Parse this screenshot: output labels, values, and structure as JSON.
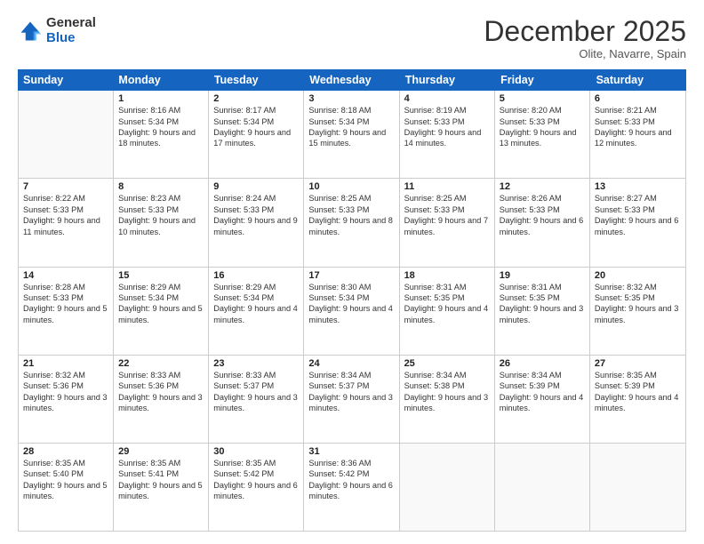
{
  "logo": {
    "general": "General",
    "blue": "Blue"
  },
  "title": "December 2025",
  "subtitle": "Olite, Navarre, Spain",
  "header_days": [
    "Sunday",
    "Monday",
    "Tuesday",
    "Wednesday",
    "Thursday",
    "Friday",
    "Saturday"
  ],
  "rows": [
    [
      {
        "day": "",
        "sunrise": "",
        "sunset": "",
        "daylight": ""
      },
      {
        "day": "1",
        "sunrise": "Sunrise: 8:16 AM",
        "sunset": "Sunset: 5:34 PM",
        "daylight": "Daylight: 9 hours and 18 minutes."
      },
      {
        "day": "2",
        "sunrise": "Sunrise: 8:17 AM",
        "sunset": "Sunset: 5:34 PM",
        "daylight": "Daylight: 9 hours and 17 minutes."
      },
      {
        "day": "3",
        "sunrise": "Sunrise: 8:18 AM",
        "sunset": "Sunset: 5:34 PM",
        "daylight": "Daylight: 9 hours and 15 minutes."
      },
      {
        "day": "4",
        "sunrise": "Sunrise: 8:19 AM",
        "sunset": "Sunset: 5:33 PM",
        "daylight": "Daylight: 9 hours and 14 minutes."
      },
      {
        "day": "5",
        "sunrise": "Sunrise: 8:20 AM",
        "sunset": "Sunset: 5:33 PM",
        "daylight": "Daylight: 9 hours and 13 minutes."
      },
      {
        "day": "6",
        "sunrise": "Sunrise: 8:21 AM",
        "sunset": "Sunset: 5:33 PM",
        "daylight": "Daylight: 9 hours and 12 minutes."
      }
    ],
    [
      {
        "day": "7",
        "sunrise": "Sunrise: 8:22 AM",
        "sunset": "Sunset: 5:33 PM",
        "daylight": "Daylight: 9 hours and 11 minutes."
      },
      {
        "day": "8",
        "sunrise": "Sunrise: 8:23 AM",
        "sunset": "Sunset: 5:33 PM",
        "daylight": "Daylight: 9 hours and 10 minutes."
      },
      {
        "day": "9",
        "sunrise": "Sunrise: 8:24 AM",
        "sunset": "Sunset: 5:33 PM",
        "daylight": "Daylight: 9 hours and 9 minutes."
      },
      {
        "day": "10",
        "sunrise": "Sunrise: 8:25 AM",
        "sunset": "Sunset: 5:33 PM",
        "daylight": "Daylight: 9 hours and 8 minutes."
      },
      {
        "day": "11",
        "sunrise": "Sunrise: 8:25 AM",
        "sunset": "Sunset: 5:33 PM",
        "daylight": "Daylight: 9 hours and 7 minutes."
      },
      {
        "day": "12",
        "sunrise": "Sunrise: 8:26 AM",
        "sunset": "Sunset: 5:33 PM",
        "daylight": "Daylight: 9 hours and 6 minutes."
      },
      {
        "day": "13",
        "sunrise": "Sunrise: 8:27 AM",
        "sunset": "Sunset: 5:33 PM",
        "daylight": "Daylight: 9 hours and 6 minutes."
      }
    ],
    [
      {
        "day": "14",
        "sunrise": "Sunrise: 8:28 AM",
        "sunset": "Sunset: 5:33 PM",
        "daylight": "Daylight: 9 hours and 5 minutes."
      },
      {
        "day": "15",
        "sunrise": "Sunrise: 8:29 AM",
        "sunset": "Sunset: 5:34 PM",
        "daylight": "Daylight: 9 hours and 5 minutes."
      },
      {
        "day": "16",
        "sunrise": "Sunrise: 8:29 AM",
        "sunset": "Sunset: 5:34 PM",
        "daylight": "Daylight: 9 hours and 4 minutes."
      },
      {
        "day": "17",
        "sunrise": "Sunrise: 8:30 AM",
        "sunset": "Sunset: 5:34 PM",
        "daylight": "Daylight: 9 hours and 4 minutes."
      },
      {
        "day": "18",
        "sunrise": "Sunrise: 8:31 AM",
        "sunset": "Sunset: 5:35 PM",
        "daylight": "Daylight: 9 hours and 4 minutes."
      },
      {
        "day": "19",
        "sunrise": "Sunrise: 8:31 AM",
        "sunset": "Sunset: 5:35 PM",
        "daylight": "Daylight: 9 hours and 3 minutes."
      },
      {
        "day": "20",
        "sunrise": "Sunrise: 8:32 AM",
        "sunset": "Sunset: 5:35 PM",
        "daylight": "Daylight: 9 hours and 3 minutes."
      }
    ],
    [
      {
        "day": "21",
        "sunrise": "Sunrise: 8:32 AM",
        "sunset": "Sunset: 5:36 PM",
        "daylight": "Daylight: 9 hours and 3 minutes."
      },
      {
        "day": "22",
        "sunrise": "Sunrise: 8:33 AM",
        "sunset": "Sunset: 5:36 PM",
        "daylight": "Daylight: 9 hours and 3 minutes."
      },
      {
        "day": "23",
        "sunrise": "Sunrise: 8:33 AM",
        "sunset": "Sunset: 5:37 PM",
        "daylight": "Daylight: 9 hours and 3 minutes."
      },
      {
        "day": "24",
        "sunrise": "Sunrise: 8:34 AM",
        "sunset": "Sunset: 5:37 PM",
        "daylight": "Daylight: 9 hours and 3 minutes."
      },
      {
        "day": "25",
        "sunrise": "Sunrise: 8:34 AM",
        "sunset": "Sunset: 5:38 PM",
        "daylight": "Daylight: 9 hours and 3 minutes."
      },
      {
        "day": "26",
        "sunrise": "Sunrise: 8:34 AM",
        "sunset": "Sunset: 5:39 PM",
        "daylight": "Daylight: 9 hours and 4 minutes."
      },
      {
        "day": "27",
        "sunrise": "Sunrise: 8:35 AM",
        "sunset": "Sunset: 5:39 PM",
        "daylight": "Daylight: 9 hours and 4 minutes."
      }
    ],
    [
      {
        "day": "28",
        "sunrise": "Sunrise: 8:35 AM",
        "sunset": "Sunset: 5:40 PM",
        "daylight": "Daylight: 9 hours and 5 minutes."
      },
      {
        "day": "29",
        "sunrise": "Sunrise: 8:35 AM",
        "sunset": "Sunset: 5:41 PM",
        "daylight": "Daylight: 9 hours and 5 minutes."
      },
      {
        "day": "30",
        "sunrise": "Sunrise: 8:35 AM",
        "sunset": "Sunset: 5:42 PM",
        "daylight": "Daylight: 9 hours and 6 minutes."
      },
      {
        "day": "31",
        "sunrise": "Sunrise: 8:36 AM",
        "sunset": "Sunset: 5:42 PM",
        "daylight": "Daylight: 9 hours and 6 minutes."
      },
      {
        "day": "",
        "sunrise": "",
        "sunset": "",
        "daylight": ""
      },
      {
        "day": "",
        "sunrise": "",
        "sunset": "",
        "daylight": ""
      },
      {
        "day": "",
        "sunrise": "",
        "sunset": "",
        "daylight": ""
      }
    ]
  ]
}
